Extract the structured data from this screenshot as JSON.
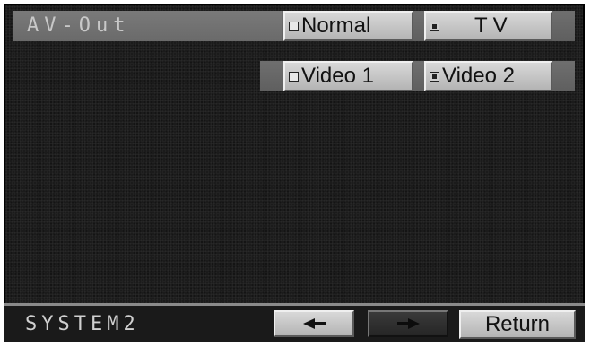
{
  "header": {
    "title": "AV-Out"
  },
  "rows": [
    {
      "buttons": [
        {
          "label": "Normal",
          "selected": false
        },
        {
          "label": "TV",
          "selected": true
        }
      ]
    },
    {
      "buttons": [
        {
          "label": "Video 1",
          "selected": false
        },
        {
          "label": "Video 2",
          "selected": true
        }
      ]
    }
  ],
  "footer": {
    "title": "SYSTEM2",
    "prev_icon": "arrow-left-icon",
    "next_icon": "arrow-right-icon",
    "return_label": "Return"
  }
}
